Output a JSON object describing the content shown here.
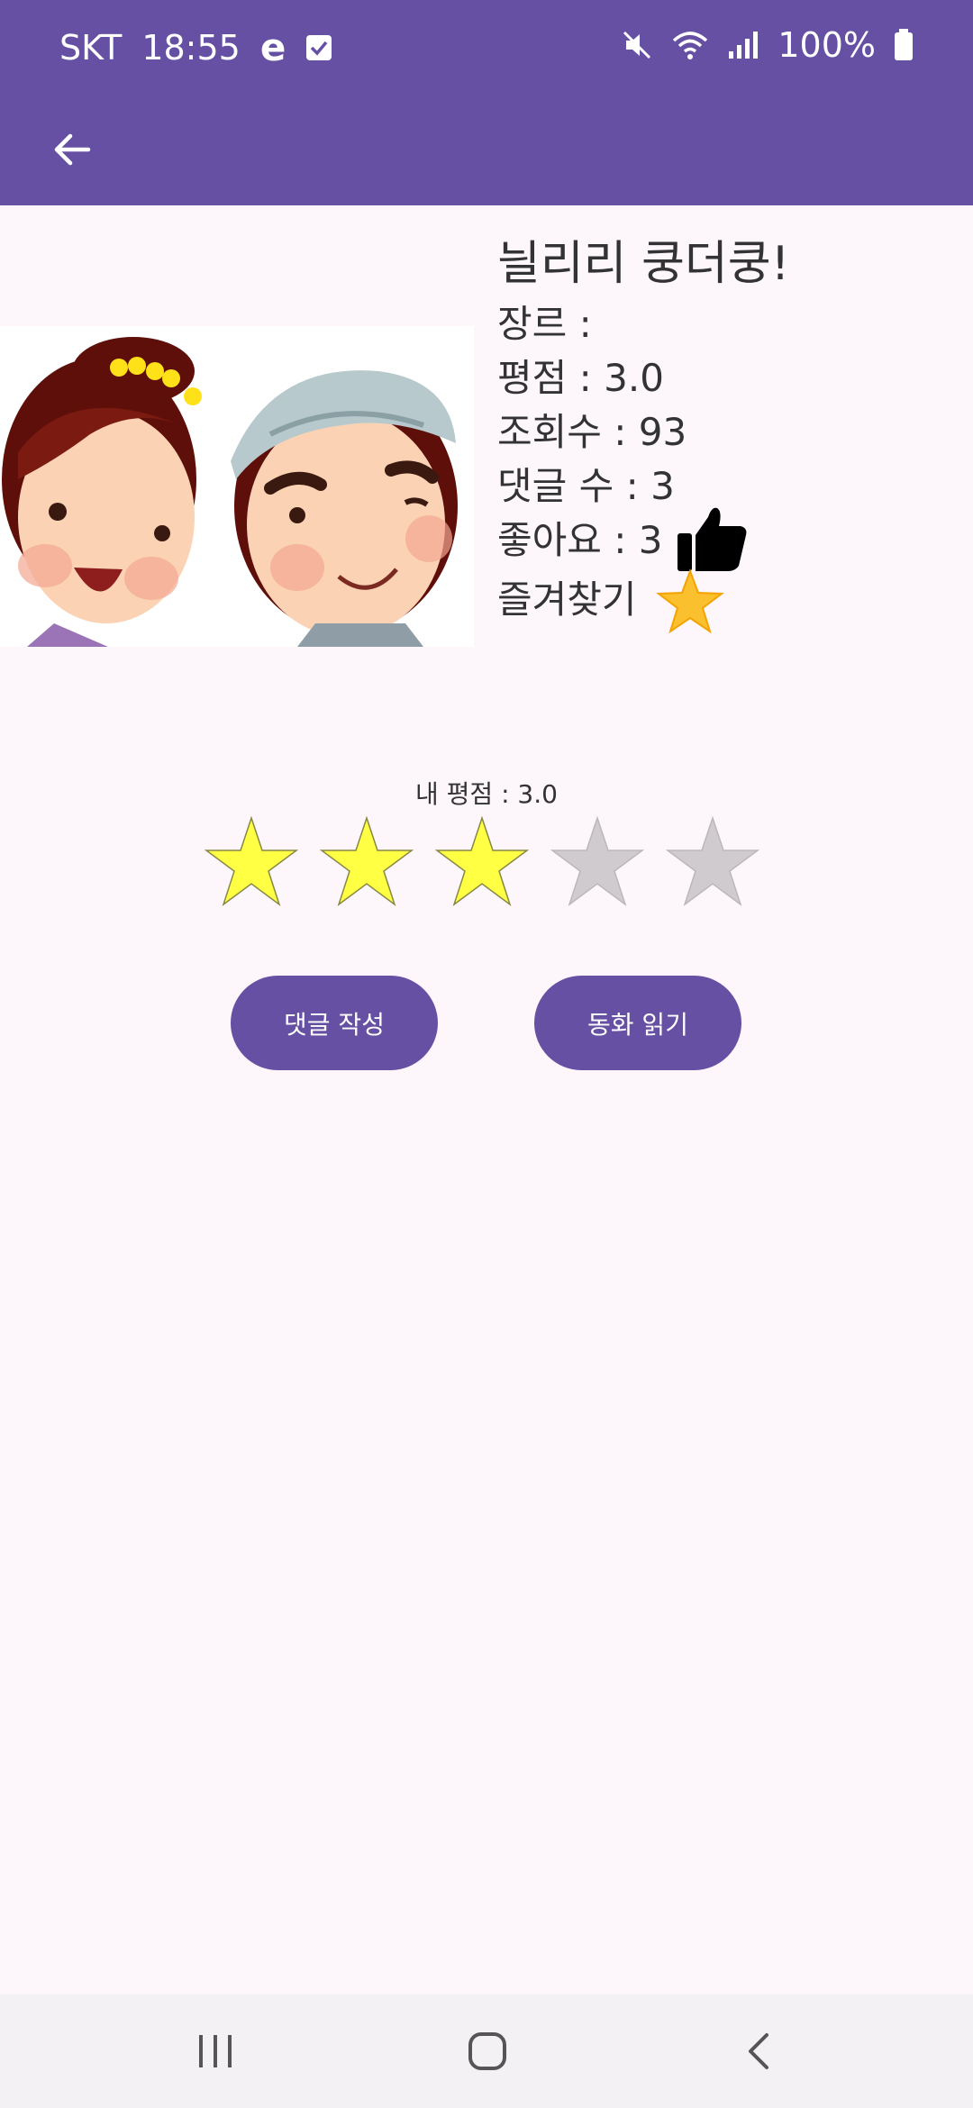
{
  "status_bar": {
    "carrier": "SKT",
    "time": "18:55",
    "battery": "100%"
  },
  "app_bar": {
    "back_icon": "arrow-left-icon"
  },
  "story": {
    "title": "늴리리 쿵더쿵!",
    "genre": "장르 :",
    "rating": "평점 : 3.0",
    "views": "조회수 : 93",
    "comments": "댓글 수 : 3",
    "likes": "좋아요 : 3",
    "favorite_label": "즐겨찾기",
    "cover_icon": "cartoon-couple-illustration",
    "like_icon": "thumbs-up-icon",
    "favorite_icon": "gold-star-icon"
  },
  "my_rating": {
    "label": "내 평점 : 3.0",
    "value": 3,
    "max": 5,
    "filled_color": "#ffff44",
    "empty_color": "#cfcbcf"
  },
  "buttons": {
    "write_comment": "댓글 작성",
    "read_story": "동화 읽기"
  },
  "nav_bar": {
    "recents_icon": "recents-icon",
    "home_icon": "home-icon",
    "back_icon": "back-icon"
  },
  "colors": {
    "primary": "#6650a4",
    "background": "#fdf7fc"
  }
}
